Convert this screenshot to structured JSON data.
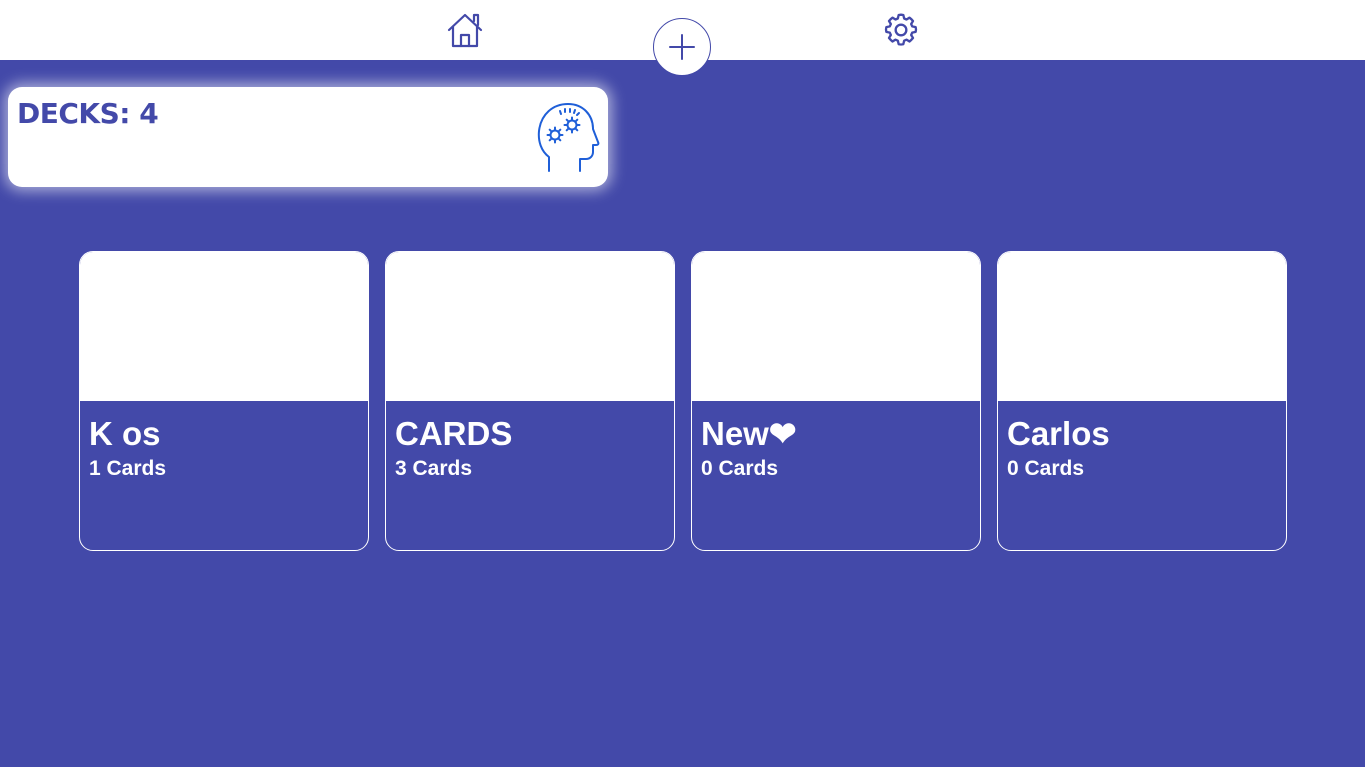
{
  "nav": {
    "home_icon": "home-icon",
    "add_icon": "plus-icon",
    "settings_icon": "gear-icon"
  },
  "summary": {
    "label": "DECKS:",
    "count": "4",
    "icon": "brain-gears-icon"
  },
  "decks": [
    {
      "name": "K os",
      "count_label": "1 Cards"
    },
    {
      "name": "CARDS",
      "count_label": "3 Cards"
    },
    {
      "name": "New❤",
      "count_label": "0 Cards"
    },
    {
      "name": "Carlos",
      "count_label": "0 Cards"
    }
  ],
  "colors": {
    "accent": "#4349a9",
    "surface": "#ffffff",
    "icon_blue": "#1f5fd8"
  }
}
